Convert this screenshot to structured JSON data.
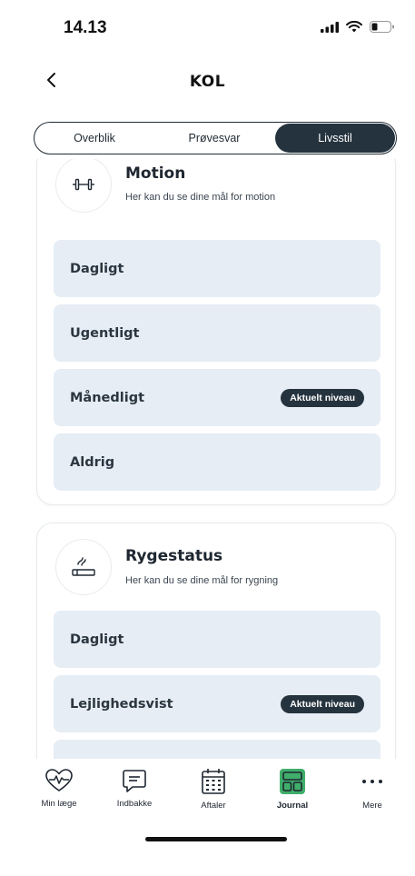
{
  "status_bar": {
    "time": "14.13"
  },
  "header": {
    "title": "KOL"
  },
  "segments": [
    {
      "label": "Overblik",
      "active": false
    },
    {
      "label": "Prøvesvar",
      "active": false
    },
    {
      "label": "Livsstil",
      "active": true
    }
  ],
  "cards": [
    {
      "title": "Motion",
      "subtitle": "Her kan du se dine mål for motion",
      "icon": "dumbbell-icon",
      "options": [
        {
          "label": "Dagligt"
        },
        {
          "label": "Ugentligt"
        },
        {
          "label": "Månedligt",
          "badge": "Aktuelt niveau"
        },
        {
          "label": "Aldrig"
        }
      ]
    },
    {
      "title": "Rygestatus",
      "subtitle": "Her kan du se dine mål for rygning",
      "icon": "cigarette-icon",
      "options": [
        {
          "label": "Dagligt"
        },
        {
          "label": "Lejlighedsvist",
          "badge": "Aktuelt niveau"
        }
      ]
    }
  ],
  "tabbar": [
    {
      "label": "Min læge",
      "icon": "heart-pulse-icon"
    },
    {
      "label": "Indbakke",
      "icon": "chat-icon"
    },
    {
      "label": "Aftaler",
      "icon": "calendar-icon"
    },
    {
      "label": "Journal",
      "icon": "journal-icon",
      "active": true
    },
    {
      "label": "Mere",
      "icon": "more-icon"
    }
  ],
  "colors": {
    "accent": "#25333e",
    "option_bg": "#e6edf4",
    "journal_green": "#3fae6a"
  }
}
